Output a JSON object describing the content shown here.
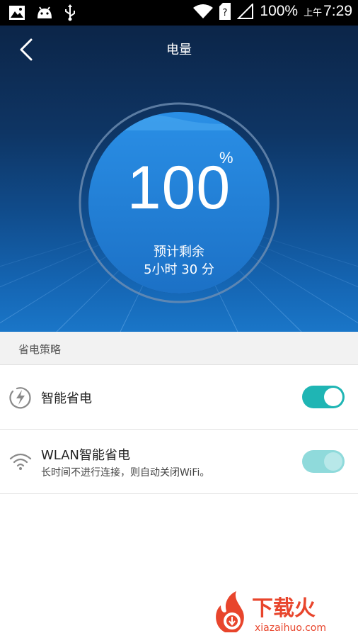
{
  "status_bar": {
    "battery_text": "100%",
    "ampm": "上午",
    "time": "7:29",
    "icons": [
      "image-icon",
      "android-icon",
      "usb-icon",
      "wifi-icon",
      "sim-icon",
      "signal-icon"
    ]
  },
  "header": {
    "title": "电量",
    "back_icon": "back-chevron-icon"
  },
  "battery": {
    "percent": "100",
    "percent_sign": "%",
    "remain_label": "预计剩余",
    "remain_value": "5小时 30 分",
    "level": 1.0
  },
  "section": {
    "title": "省电策略"
  },
  "settings": [
    {
      "title": "智能省电",
      "icon": "smart-power-icon",
      "enabled": true
    },
    {
      "title": "WLAN智能省电",
      "subtitle": "长时间不进行连接，则自动关闭WiFi。",
      "icon": "wifi-icon",
      "enabled": true,
      "dimmed": true
    }
  ],
  "watermark": {
    "brand": "下载火",
    "domain": "xiazaihuo.com"
  },
  "colors": {
    "accent": "#1fb5b4",
    "accent_dim": "#8fdadb",
    "hero_top": "#0c2548",
    "hero_bottom": "#1a76c8",
    "brand_red": "#e8452c"
  }
}
